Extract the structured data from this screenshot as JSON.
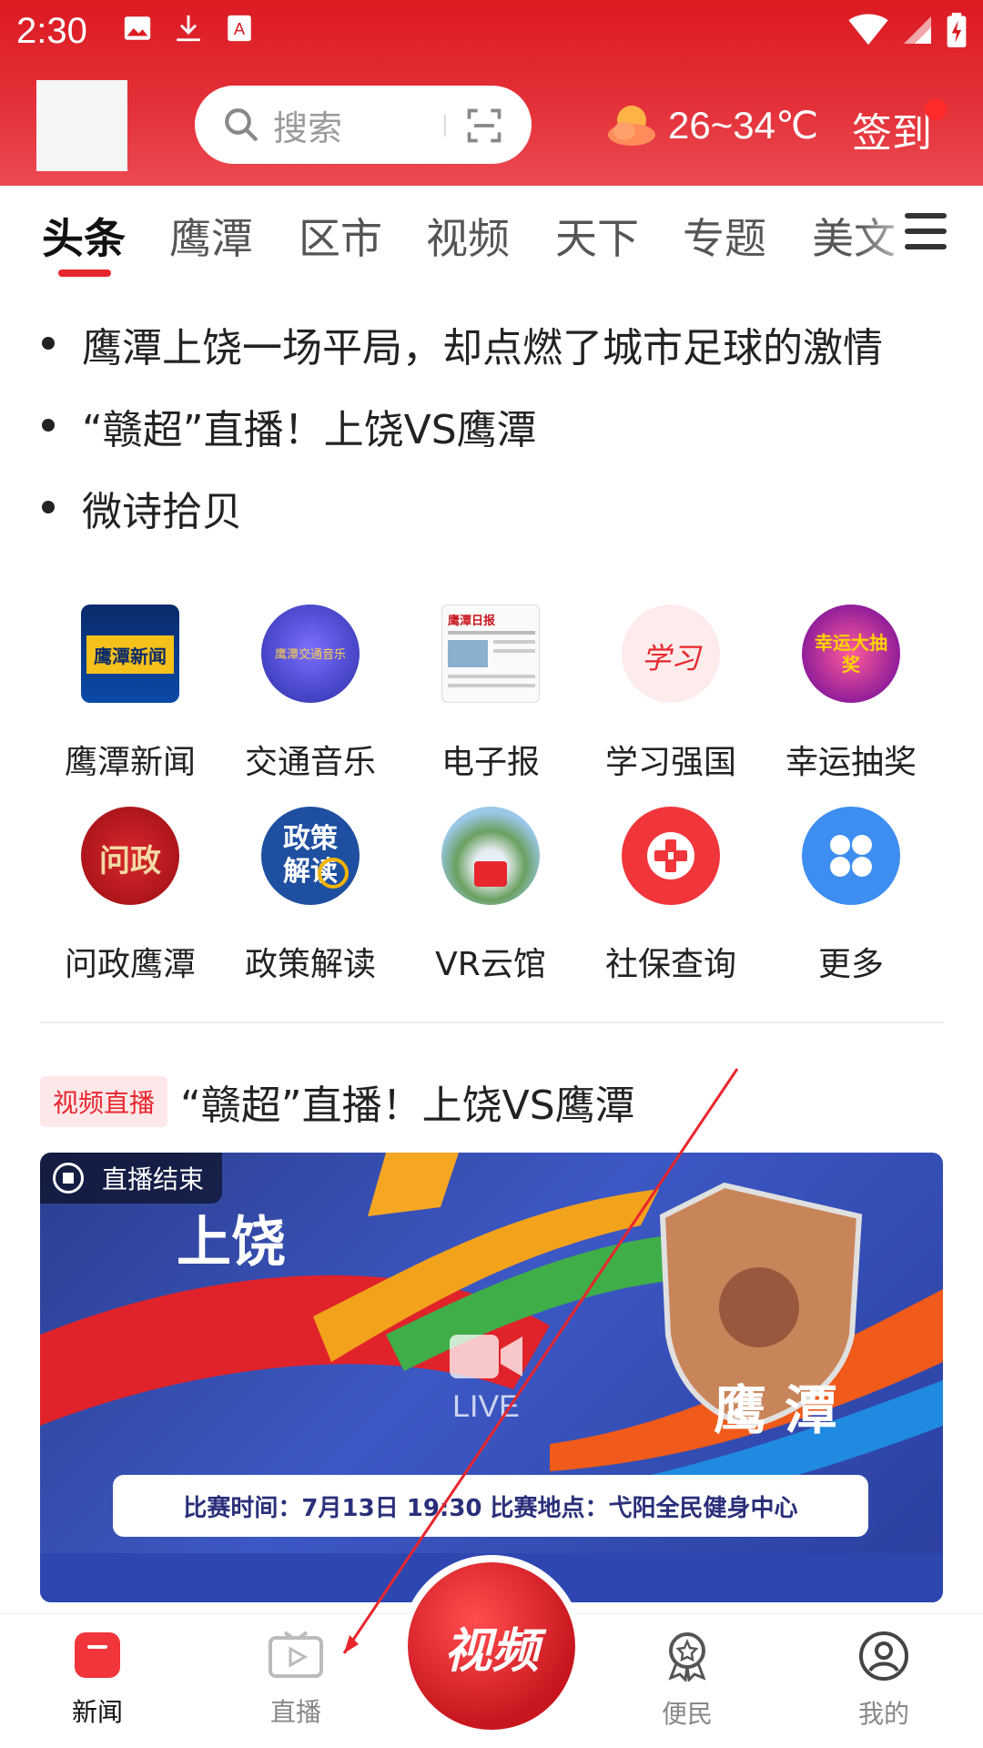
{
  "status_bar": {
    "time": "2:30"
  },
  "header": {
    "search_placeholder": "搜索",
    "weather_temp": "26~34℃",
    "signin_label": "签到"
  },
  "tabs": [
    {
      "label": "头条",
      "active": true
    },
    {
      "label": "鹰潭"
    },
    {
      "label": "区市"
    },
    {
      "label": "视频"
    },
    {
      "label": "天下"
    },
    {
      "label": "专题"
    },
    {
      "label": "美文"
    }
  ],
  "headlines": [
    "鹰潭上饶一场平局，却点燃了城市足球的激情",
    "“赣超”直播！上饶VS鹰潭",
    "微诗拾贝"
  ],
  "services": [
    {
      "label": "鹰潭新闻",
      "icon": "yingtan-news-icon",
      "icon_text": "鹰潭新闻"
    },
    {
      "label": "交通音乐",
      "icon": "traffic-music-icon",
      "icon_text": "鹰潭交通音乐"
    },
    {
      "label": "电子报",
      "icon": "e-newspaper-icon",
      "icon_text": "鹰潭日报"
    },
    {
      "label": "学习强国",
      "icon": "xuexi-icon",
      "icon_text": "学习"
    },
    {
      "label": "幸运抽奖",
      "icon": "lucky-draw-icon",
      "icon_text": "幸运大抽奖"
    },
    {
      "label": "问政鹰潭",
      "icon": "wenzheng-icon",
      "icon_text": "问政"
    },
    {
      "label": "政策解读",
      "icon": "policy-icon",
      "icon_text": "政策解读"
    },
    {
      "label": "VR云馆",
      "icon": "vr-hall-icon",
      "icon_text": ""
    },
    {
      "label": "社保查询",
      "icon": "social-security-icon",
      "icon_text": ""
    },
    {
      "label": "更多",
      "icon": "more-icon",
      "icon_text": ""
    }
  ],
  "live_card": {
    "tag": "视频直播",
    "title": "“赣超”直播！上饶VS鹰潭",
    "status": "直播结束",
    "team_left": "上饶",
    "team_right": "鹰潭",
    "play_label": "LIVE",
    "info": "比赛时间：7月13日 19:30   比赛地点：弋阳全民健身中心"
  },
  "bottom_nav": [
    {
      "label": "新闻",
      "icon": "news-icon",
      "active": true
    },
    {
      "label": "直播",
      "icon": "live-icon"
    },
    {
      "label": "视频",
      "icon": "video-center-icon"
    },
    {
      "label": "便民",
      "icon": "convenience-icon"
    },
    {
      "label": "我的",
      "icon": "profile-icon"
    }
  ],
  "colors": {
    "brand_red": "#dc1a22",
    "accent_red": "#e8262d"
  }
}
